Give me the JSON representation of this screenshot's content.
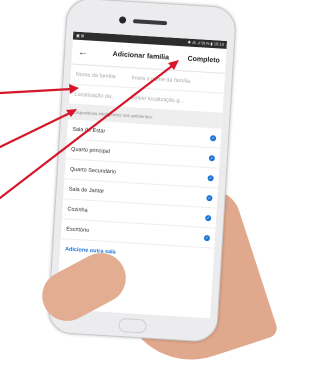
{
  "status": {
    "left": "▣ ⊞",
    "right": "✱ ⁂ .ıl 91% ▮ 10:13"
  },
  "header": {
    "back_glyph": "←",
    "title": "Adicionar família",
    "done_label": "Completo"
  },
  "form": [
    {
      "label": "Nome da família",
      "value": "Insira o nome da família"
    },
    {
      "label": "Localização da...",
      "value": "Definir localização g..."
    }
  ],
  "section_label": "Dispositivos inteligentes nos ambientes:",
  "rooms": [
    {
      "name": "Sala de Estar"
    },
    {
      "name": "Quarto principal"
    },
    {
      "name": "Quarto Secundário"
    },
    {
      "name": "Sala de Jantar"
    },
    {
      "name": "Cozinha"
    },
    {
      "name": "Escritório"
    }
  ],
  "check_glyph": "✓",
  "add_room_label": "Adicione outra sala",
  "colors": {
    "accent": "#1e74d8",
    "arrow": "#d6162b"
  }
}
